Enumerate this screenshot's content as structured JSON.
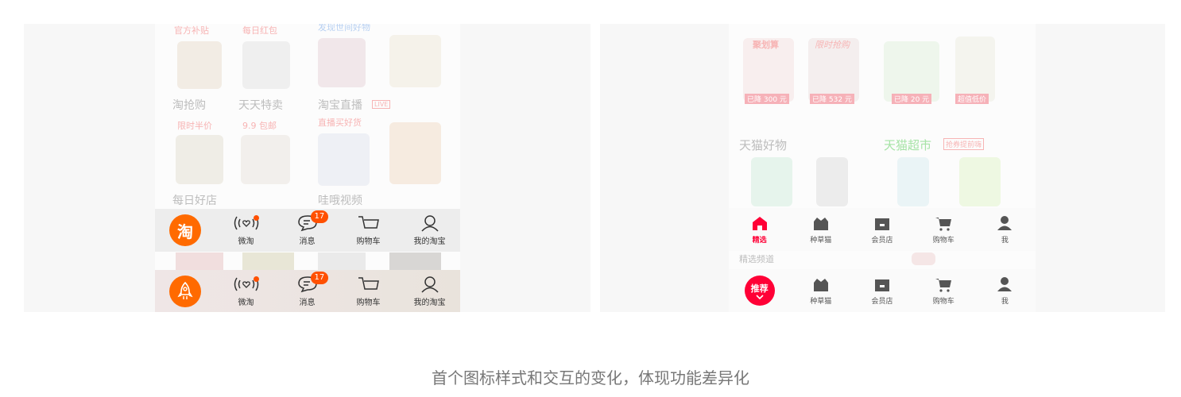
{
  "left_panel": {
    "bg_labels": {
      "top1": "官方补贴",
      "top2": "每日红包",
      "top3": "发现世间好物",
      "row1_a": "淘抢购",
      "row1_b": "天天特卖",
      "row1_c": "淘宝直播",
      "row1_sub_a": "限时半价",
      "row1_sub_b": "9.9 包邮",
      "row1_sub_c": "直播买好货",
      "row2_a": "每日好店",
      "row2_c": "哇哦视频"
    },
    "tabbar_top": {
      "logo_char": "淘",
      "items": [
        "微淘",
        "消息",
        "购物车",
        "我的淘宝"
      ],
      "message_badge": "17"
    },
    "tabbar_bottom": {
      "items": [
        "微淘",
        "消息",
        "购物车",
        "我的淘宝"
      ],
      "message_badge": "17"
    }
  },
  "right_panel": {
    "bg_labels": {
      "promo1": "聚划算",
      "promo2": "限时抢购",
      "price1": "已降 300 元",
      "price2": "已降 532 元",
      "price3": "已降 20 元",
      "price4": "超值低价",
      "sec1": "天猫好物",
      "sec2": "天猫超市",
      "sec2_tag": "抢券提前嗨",
      "row_below": "精选频道"
    },
    "tabbar_top": {
      "items": [
        "精选",
        "种草猫",
        "会员店",
        "购物车",
        "我"
      ]
    },
    "tabbar_bottom": {
      "first_label": "推荐",
      "items": [
        "种草猫",
        "会员店",
        "购物车",
        "我"
      ]
    }
  },
  "caption": "首个图标样式和交互的变化，体现功能差异化",
  "colors": {
    "taobao_orange": "#ff6a00",
    "tmall_red": "#ff0036",
    "badge": "#ff5000"
  }
}
